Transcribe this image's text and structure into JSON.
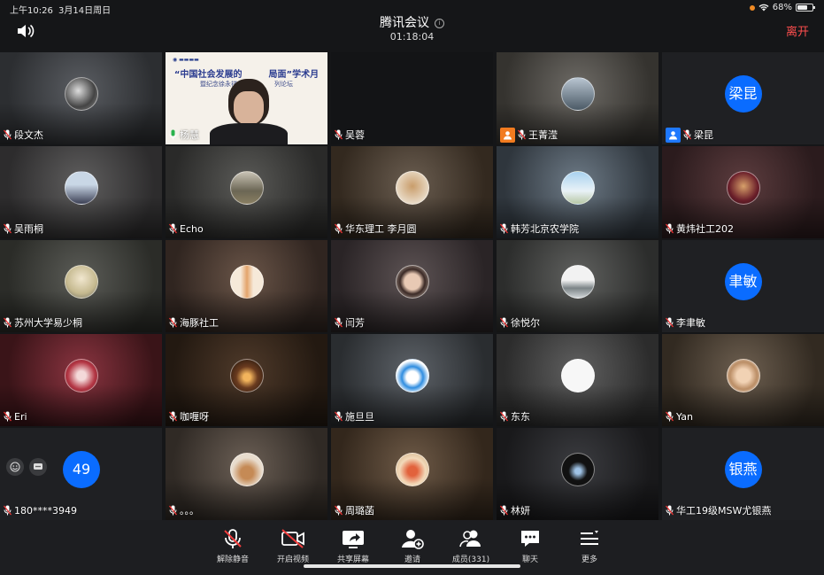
{
  "status": {
    "time": "上午10:26",
    "date": "3月14日周日",
    "battery": "68%",
    "battery_level": 0.68
  },
  "header": {
    "title": "腾讯会议",
    "timer": "01:18:04",
    "leave_label": "离开"
  },
  "participants": [
    {
      "name": "段文杰"
    },
    {
      "name": "杨慧"
    },
    {
      "name": "吴蓉"
    },
    {
      "name": "王菁滢"
    },
    {
      "name": "梁昆",
      "avatar_text": "梁昆"
    },
    {
      "name": "吴雨桐"
    },
    {
      "name": "Echo"
    },
    {
      "name": "华东理工 李月圆"
    },
    {
      "name": "韩芳北京农学院"
    },
    {
      "name": "黄炜社工202"
    },
    {
      "name": "苏州大学易少桐"
    },
    {
      "name": "海豚社工"
    },
    {
      "name": "闫芳"
    },
    {
      "name": "徐悦尔"
    },
    {
      "name": "李聿敏",
      "avatar_text": "聿敏"
    },
    {
      "name": "Eri"
    },
    {
      "name": "咖喱呀"
    },
    {
      "name": "施旦旦"
    },
    {
      "name": "东东"
    },
    {
      "name": "Yan"
    },
    {
      "name": "180****3949",
      "avatar_text": "49"
    },
    {
      "name": "。。。"
    },
    {
      "name": "周璐菡"
    },
    {
      "name": "林妍"
    },
    {
      "name": "华工19级MSW尤银燕",
      "avatar_text": "银燕"
    }
  ],
  "shared_slide": {
    "line1": "“中国社会发展的",
    "line1b": "局面”学术月",
    "line2": "暨纪念徐永祥",
    "line2b": "列论坛"
  },
  "toolbar": {
    "unmute": "解除静音",
    "video": "开启视频",
    "share": "共享屏幕",
    "invite": "邀请",
    "members": "成员(331)",
    "chat": "聊天",
    "more": "更多"
  }
}
